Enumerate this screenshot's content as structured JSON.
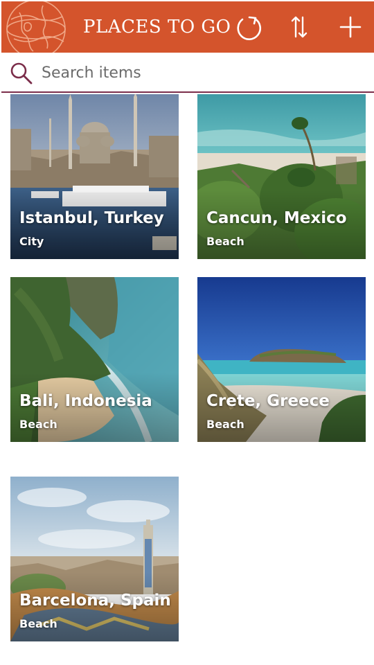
{
  "header": {
    "title": "PLACES TO GO",
    "icons": [
      "globe-icon",
      "refresh-icon",
      "sort-icon",
      "add-icon"
    ],
    "color": "#d4542c"
  },
  "search": {
    "placeholder": "Search items",
    "value": "",
    "accent": "#7b2d4a"
  },
  "places": [
    {
      "name": "Istanbul, Turkey",
      "category": "City"
    },
    {
      "name": "Cancun, Mexico",
      "category": "Beach"
    },
    {
      "name": "Bali, Indonesia",
      "category": "Beach"
    },
    {
      "name": "Crete, Greece",
      "category": "Beach"
    },
    {
      "name": "Barcelona, Spain",
      "category": "Beach"
    }
  ]
}
